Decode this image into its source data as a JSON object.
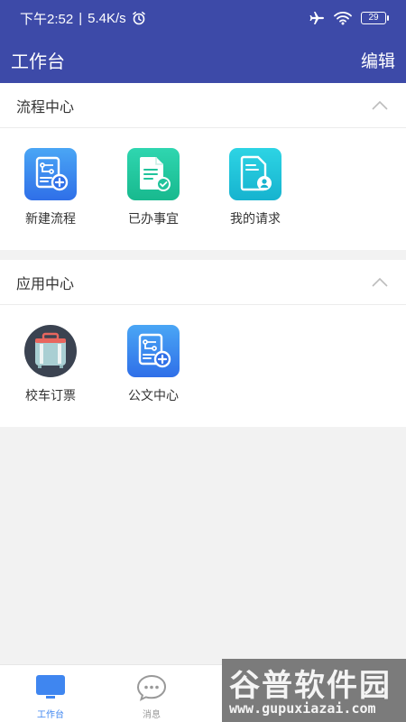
{
  "status_bar": {
    "time": "下午2:52",
    "separator": "|",
    "speed": "5.4K/s",
    "battery": "29"
  },
  "header": {
    "title": "工作台",
    "edit_label": "编辑"
  },
  "sections": [
    {
      "title": "流程中心",
      "items": [
        {
          "label": "新建流程",
          "icon": "new-process-icon"
        },
        {
          "label": "已办事宜",
          "icon": "done-tasks-icon"
        },
        {
          "label": "我的请求",
          "icon": "my-requests-icon"
        }
      ]
    },
    {
      "title": "应用中心",
      "items": [
        {
          "label": "校车订票",
          "icon": "school-bus-ticket-icon"
        },
        {
          "label": "公文中心",
          "icon": "official-documents-icon"
        }
      ]
    }
  ],
  "bottom_nav": {
    "items": [
      {
        "label": "工作台",
        "icon": "monitor-icon",
        "active": true
      },
      {
        "label": "消息",
        "icon": "chat-bubble-icon",
        "active": false
      }
    ]
  },
  "watermark": {
    "title": "谷普软件园",
    "url": "www.gupuxiazai.com"
  },
  "colors": {
    "brand": "#3d4aa8",
    "nav_active": "#3f86f0",
    "nav_inactive": "#999999"
  }
}
